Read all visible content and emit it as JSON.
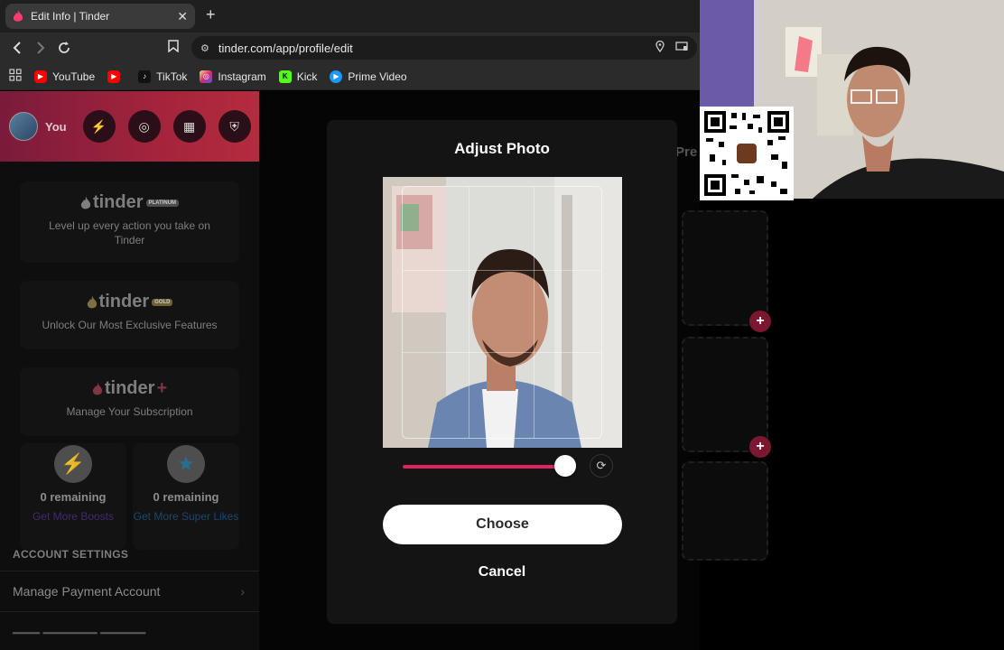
{
  "browser": {
    "tab_title": "Edit Info | Tinder",
    "url": "tinder.com/app/profile/edit",
    "bookmarks": [
      {
        "label": "YouTube",
        "color": "#ff0000"
      },
      {
        "label": "",
        "color": "#ff0000"
      },
      {
        "label": "TikTok",
        "color": "#111111"
      },
      {
        "label": "Instagram",
        "color": "#d62976"
      },
      {
        "label": "Kick",
        "color": "#53fc18"
      },
      {
        "label": "Prime Video",
        "color": "#1a98ff"
      }
    ]
  },
  "sidebar": {
    "user_label": "You",
    "cards": {
      "platinum": {
        "brand": "tinder",
        "badge": "PLATINUM",
        "desc": "Level up every action you take on Tinder"
      },
      "gold": {
        "brand": "tinder",
        "badge": "GOLD",
        "desc": "Unlock Our Most Exclusive Features"
      },
      "plus": {
        "brand": "tinder",
        "badge": "+",
        "desc": "Manage Your Subscription"
      }
    },
    "boosts": {
      "remaining": "0 remaining",
      "link": "Get More Boosts"
    },
    "super_likes": {
      "remaining": "0 remaining",
      "link": "Get More Super Likes"
    },
    "account_settings_title": "ACCOUNT SETTINGS",
    "manage_payment": "Manage Payment Account"
  },
  "main": {
    "partial_tab": "Pre"
  },
  "modal": {
    "title": "Adjust Photo",
    "zoom": 1.0,
    "choose_label": "Choose",
    "cancel_label": "Cancel"
  },
  "colors": {
    "accent": "#e0245e",
    "brand_gradient_start": "#7a1b3b",
    "brand_gradient_end": "#b52b3e"
  }
}
